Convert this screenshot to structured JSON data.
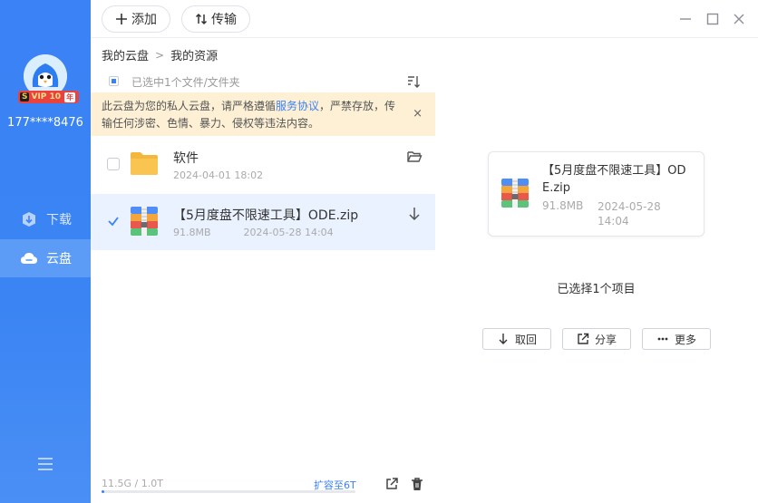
{
  "user": {
    "phone": "177****8476",
    "vip_label": "VIP 10",
    "vip_year": "年",
    "vip_s": "S"
  },
  "nav": {
    "download": "下载",
    "cloud": "云盘"
  },
  "toolbar": {
    "add": "添加",
    "transfer": "传输"
  },
  "breadcrumb": {
    "root": "我的云盘",
    "current": "我的资源"
  },
  "selection": {
    "text": "已选中1个文件/文件夹"
  },
  "notice": {
    "before": "此云盘为您的私人云盘，请严格遵循",
    "link": "服务协议",
    "after": "，严禁存放，传输任何涉密、色情、暴力、侵权等违法内容。",
    "close": "×"
  },
  "files": [
    {
      "name": "软件",
      "date": "2024-04-01 18:02",
      "size": "",
      "type": "folder",
      "checked": false
    },
    {
      "name": "【5月度盘不限速工具】ODE.zip",
      "date": "2024-05-28 14:04",
      "size": "91.8MB",
      "type": "zip",
      "checked": true
    }
  ],
  "storage": {
    "text": "11.5G / 1.0T",
    "used_fraction": 0.0112,
    "expand": "扩容至6T"
  },
  "detail": {
    "name": "【5月度盘不限速工具】ODE.zip",
    "size": "91.8MB",
    "date": "2024-05-28 14:04",
    "selected_count": "已选择1个项目",
    "actions": {
      "retrieve": "取回",
      "share": "分享",
      "more": "更多"
    }
  },
  "colors": {
    "accent": "#3b82f6",
    "sidebar": "#3b82f6",
    "notice_bg": "#fdf0d5",
    "selected_row": "#eaf2ff"
  }
}
